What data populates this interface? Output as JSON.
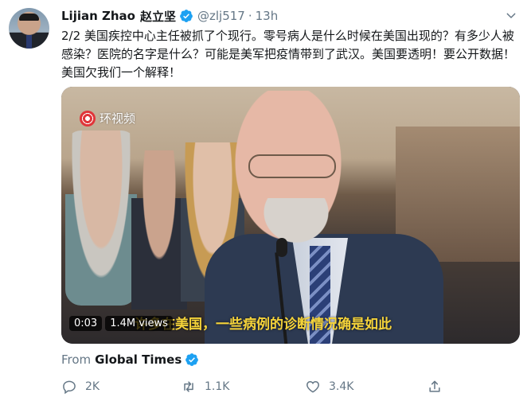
{
  "tweet": {
    "author_name": "Lijian Zhao",
    "author_name_cn": "赵立坚",
    "handle": "@zlj517",
    "separator": "·",
    "time": "13h",
    "text": "2/2 美国疾控中心主任被抓了个现行。零号病人是什么时候在美国出现的？有多少人被感染？医院的名字是什么？可能是美军把疫情带到了武汉。美国要透明！要公开数据！美国欠我们一个解释！",
    "verified_color": "#1da1f2"
  },
  "media": {
    "watermark": "环视频",
    "subtitle": "许多在美国，一些病例的诊断情况确是如此",
    "duration": "0:03",
    "views": "1.4M views"
  },
  "source": {
    "from_label": "From",
    "name": "Global Times"
  },
  "actions": {
    "replies": "2K",
    "retweets": "1.1K",
    "likes": "3.4K"
  },
  "icons": [
    "verified-badge-icon",
    "chevron-down-icon",
    "reply-icon",
    "retweet-icon",
    "like-icon",
    "share-icon"
  ]
}
